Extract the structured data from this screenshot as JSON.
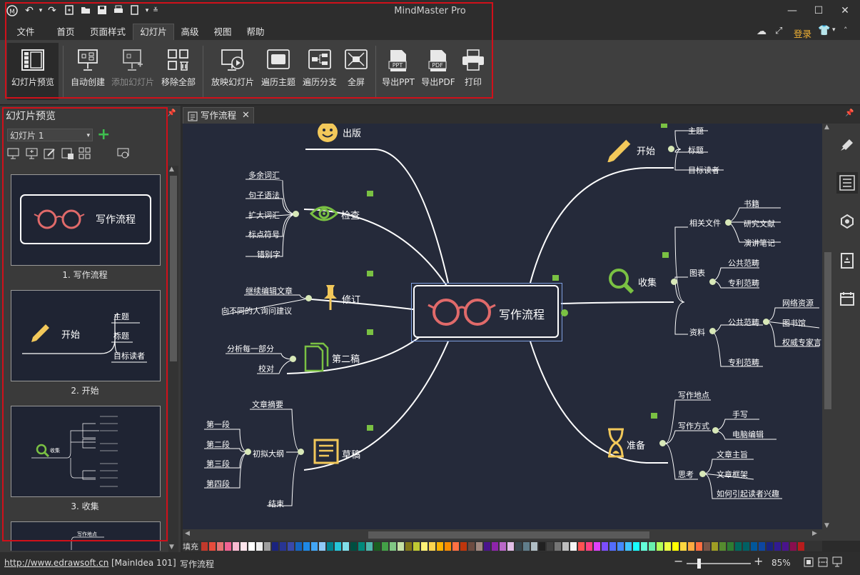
{
  "app": {
    "title": "MindMaster Pro"
  },
  "menu": {
    "items": [
      "文件",
      "首页",
      "页面样式",
      "幻灯片",
      "高级",
      "视图",
      "帮助"
    ],
    "active": "幻灯片",
    "login": "登录"
  },
  "ribbon": {
    "buttons": [
      {
        "label": "幻灯片预览",
        "icon": "slide-preview-icon",
        "selected": true
      },
      {
        "label": "自动创建",
        "icon": "auto-create-icon"
      },
      {
        "label": "添加幻灯片",
        "icon": "add-slide-icon",
        "disabled": true
      },
      {
        "label": "移除全部",
        "icon": "remove-all-icon"
      },
      {
        "label": "放映幻灯片",
        "icon": "play-slideshow-icon"
      },
      {
        "label": "遍历主题",
        "icon": "traverse-topic-icon"
      },
      {
        "label": "遍历分支",
        "icon": "traverse-branch-icon"
      },
      {
        "label": "全屏",
        "icon": "fullscreen-icon"
      },
      {
        "label": "导出PPT",
        "icon": "export-ppt-icon",
        "badge": "PPT"
      },
      {
        "label": "导出PDF",
        "icon": "export-pdf-icon",
        "badge": "PDF"
      },
      {
        "label": "打印",
        "icon": "print-icon"
      }
    ]
  },
  "left_panel": {
    "title": "幻灯片预览",
    "select_value": "幻灯片 1",
    "thumbnails": [
      {
        "caption": "1. 写作流程",
        "title": "写作流程"
      },
      {
        "caption": "2. 开始",
        "title": "开始",
        "items": [
          "主题",
          "标题",
          "目标读者"
        ]
      },
      {
        "caption": "3. 收集",
        "title": "收集"
      },
      {
        "caption": "",
        "title": "写作地点"
      }
    ]
  },
  "doc_tab": {
    "label": "写作流程"
  },
  "mindmap": {
    "central": "写作流程",
    "branches": {
      "publish": {
        "label": "出版"
      },
      "check": {
        "label": "检查",
        "items": [
          "多余词汇",
          "句子语法",
          "扩大词汇",
          "标点符号",
          "错别字"
        ]
      },
      "revise": {
        "label": "修订",
        "items": [
          "继续编辑文章",
          "向不同的人询问建议"
        ]
      },
      "draft2": {
        "label": "第二稿",
        "items": [
          "分析每一部分",
          "校对"
        ]
      },
      "draft": {
        "label": "草稿",
        "items": [
          "文章摘要",
          "初拟大纲",
          "结束"
        ],
        "outline": [
          "第一段",
          "第二段",
          "第三段",
          "第四段"
        ]
      },
      "start": {
        "label": "开始",
        "items": [
          "主题",
          "标题",
          "目标读者"
        ]
      },
      "collect": {
        "label": "收集",
        "items": [
          "相关文件",
          "图表",
          "资料"
        ],
        "docs": [
          "书籍",
          "研究文献",
          "演讲笔记"
        ],
        "charts": [
          "公共范畴",
          "专利范畴"
        ],
        "material": [
          "公共范畴",
          "专利范畴"
        ],
        "material_sub": [
          "网络资源",
          "图书馆",
          "权威专家言"
        ]
      },
      "prepare": {
        "label": "准备",
        "items": [
          "写作地点",
          "写作方式",
          "思考"
        ],
        "method": [
          "手写",
          "电脑编辑"
        ],
        "think": [
          "文章主旨",
          "文章框架",
          "如何引起读者兴趣"
        ]
      }
    }
  },
  "colorbar": {
    "label": "填充"
  },
  "status": {
    "url": "http://www.edrawsoft.cn",
    "node": "[MainIdea 101]",
    "topic": "写作流程",
    "zoom": "85%"
  }
}
